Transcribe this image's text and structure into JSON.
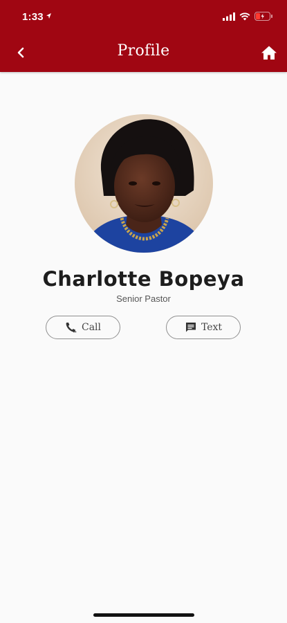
{
  "status_bar": {
    "time": "1:33"
  },
  "nav": {
    "title": "Profile",
    "back_icon": "chevron-left-icon",
    "home_icon": "home-icon"
  },
  "profile": {
    "name": "Charlotte Bopeya",
    "role": "Senior Pastor"
  },
  "actions": {
    "call_label": "Call",
    "call_icon": "phone-icon",
    "text_label": "Text",
    "text_icon": "message-icon"
  },
  "colors": {
    "header": "#a00612",
    "background": "#fafafa",
    "name_text": "#1d1d1d"
  }
}
